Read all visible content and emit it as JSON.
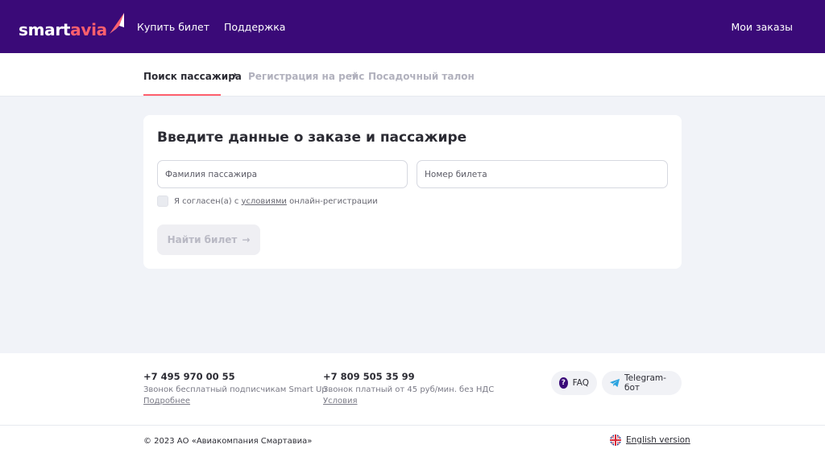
{
  "header": {
    "logo": {
      "part1": "smart",
      "part2": "avia"
    },
    "nav": [
      "Купить билет",
      "Поддержка"
    ],
    "my_orders": "Мои заказы"
  },
  "steps": [
    {
      "label": "Поиск пассажира",
      "state": "active"
    },
    {
      "label": "Регистрация на рейс",
      "state": "upcoming"
    },
    {
      "label": "Посадочный талон",
      "state": "upcoming"
    }
  ],
  "form": {
    "title": "Введите данные о заказе и пассажире",
    "surname_placeholder": "Фамилия пассажира",
    "surname_value": "",
    "ticket_placeholder": "Номер билета",
    "ticket_value": "",
    "agree_prefix": "Я согласен(а) с ",
    "agree_link": "условиями",
    "agree_suffix": " онлайн-регистрации",
    "agree_checked": false,
    "submit_label": "Найти билет",
    "submit_enabled": false
  },
  "footer": {
    "contacts": [
      {
        "phone": "+7 495 970 00 55",
        "note": "Звонок бесплатный подписчикам Smart Up",
        "link": "Подробнее"
      },
      {
        "phone": "+7 809 505 35 99",
        "note": "Звонок платный от 45 руб/мин. без НДС",
        "link": "Условия"
      }
    ],
    "faq_label": "FAQ",
    "telegram_label": "Telegram-бот",
    "copyright": "© 2023 АО «Авиакомпания Смартавиа»",
    "language_label": "English version"
  },
  "colors": {
    "header_bg": "#3a0a78",
    "accent": "#ff5f6d",
    "page_bg": "#f1f3f8",
    "telegram": "#2aa3df"
  },
  "icons": {
    "step_arrow": "arrow-right-icon",
    "faq": "question-icon",
    "telegram": "telegram-icon",
    "language": "uk-flag-icon",
    "logo": "smartavia-logo"
  }
}
